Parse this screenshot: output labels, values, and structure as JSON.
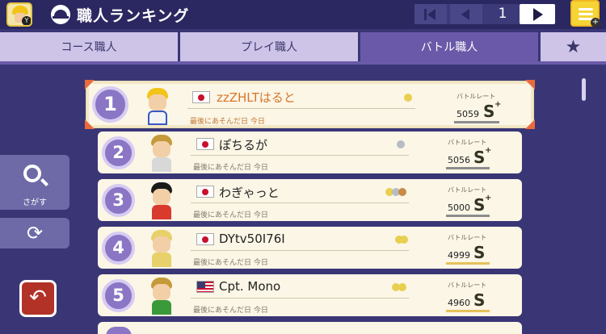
{
  "header": {
    "title": "職人ランキング",
    "page_number": "1"
  },
  "tabs": [
    {
      "label": "コース職人",
      "active": false
    },
    {
      "label": "プレイ職人",
      "active": false
    },
    {
      "label": "バトル職人",
      "active": true
    },
    {
      "label": "★",
      "active": false
    }
  ],
  "side": {
    "search_label": "さがす"
  },
  "rows": [
    {
      "rank": "1",
      "flag": "jp",
      "name": "zzZHLTはると",
      "last_played": "最後にあそんだ日 今日",
      "rate_label": "バトルレート",
      "rate": "5059",
      "grade": "S",
      "plus": "+",
      "medal": "gold",
      "underline": "#8c8c8c"
    },
    {
      "rank": "2",
      "flag": "jp",
      "name": "ぽちるが",
      "last_played": "最後にあそんだ日 今日",
      "rate_label": "バトルレート",
      "rate": "5056",
      "grade": "S",
      "plus": "+",
      "medal": "silver",
      "underline": "#8c8c8c"
    },
    {
      "rank": "3",
      "flag": "jp",
      "name": "わぎゃっと",
      "last_played": "最後にあそんだ日 今日",
      "rate_label": "バトルレート",
      "rate": "5000",
      "grade": "S",
      "plus": "+",
      "medal": "mixed",
      "underline": "#8c8c8c"
    },
    {
      "rank": "4",
      "flag": "jp",
      "name": "DYtv50I76I",
      "last_played": "最後にあそんだ日 今日",
      "rate_label": "バトルレート",
      "rate": "4999",
      "grade": "S",
      "plus": "",
      "medal": "gold2",
      "underline": "#e5c15a"
    },
    {
      "rank": "5",
      "flag": "us",
      "name": "Cpt. Mono",
      "last_played": "最後にあそんだ日 今日",
      "rate_label": "バトルレート",
      "rate": "4960",
      "grade": "S",
      "plus": "",
      "medal": "gold2",
      "underline": "#e5c15a"
    }
  ],
  "colors": {
    "background": "#3a3676",
    "header": "#2b2760",
    "tab_active": "#6a59a9",
    "tab_inactive": "#cdc4e8",
    "row_bg": "#fbf6e6",
    "rank_circle": "#8a76c4",
    "first_accent": "#e96a3c",
    "menu_button": "#f7d436"
  }
}
